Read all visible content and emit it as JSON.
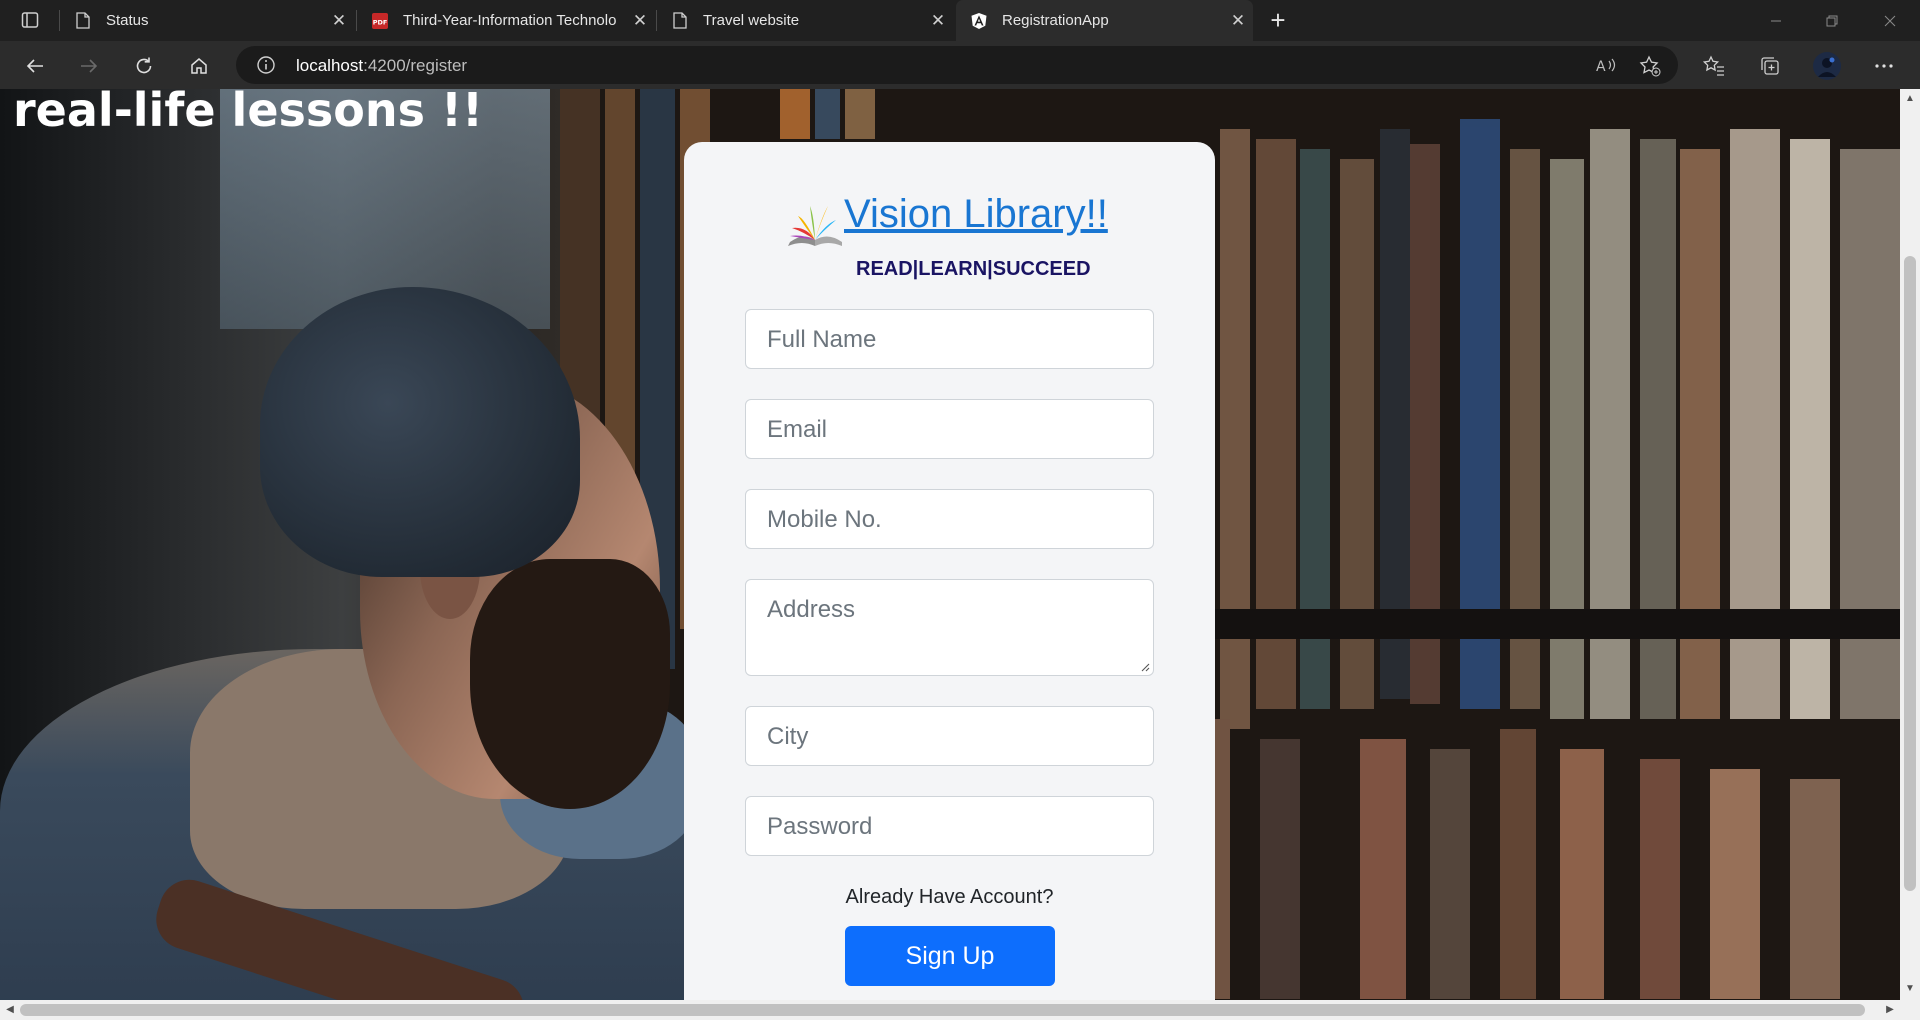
{
  "browser": {
    "tabs": [
      {
        "title": "Status",
        "icon": "page-icon"
      },
      {
        "title": "Third-Year-Information Technolo",
        "icon": "pdf-icon"
      },
      {
        "title": "Travel website",
        "icon": "page-icon"
      },
      {
        "title": "RegistrationApp",
        "icon": "angular-icon"
      }
    ],
    "active_tab_index": 3,
    "close_glyph": "✕",
    "new_tab_glyph": "+",
    "url_host": "localhost",
    "url_rest": ":4200/register"
  },
  "page": {
    "headline": "real-life lessons !!",
    "brand": {
      "title": "Vision Library!!",
      "tagline": "READ|LEARN|SUCCEED"
    },
    "form": {
      "full_name_placeholder": "Full Name",
      "email_placeholder": "Email",
      "mobile_placeholder": "Mobile No.",
      "address_placeholder": "Address",
      "city_placeholder": "City",
      "password_placeholder": "Password",
      "already_text": "Already Have Account?",
      "signup_label": "Sign Up"
    }
  },
  "colors": {
    "brand_link": "#1976d2",
    "tagline": "#1a1463",
    "primary_button": "#0d6efd",
    "card_bg": "#f4f5f7"
  }
}
